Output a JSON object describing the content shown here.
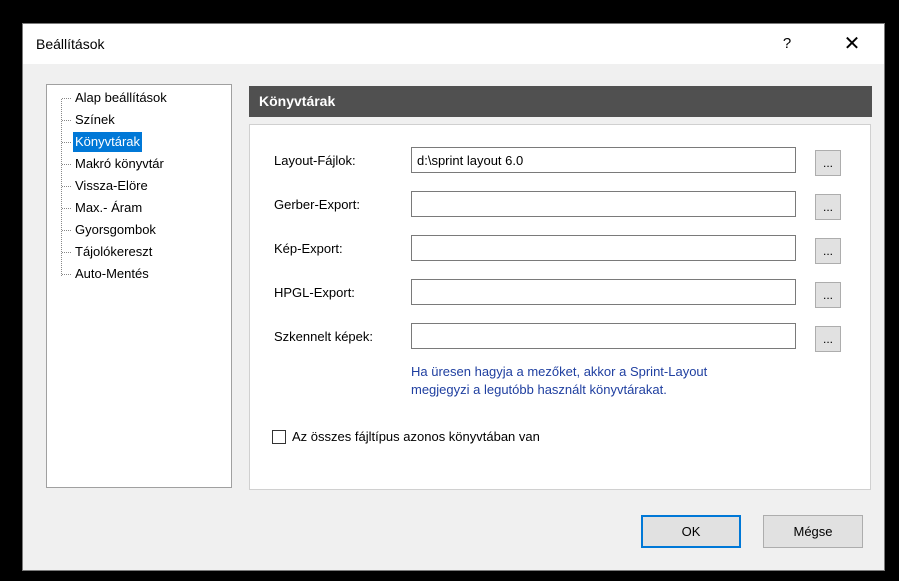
{
  "window": {
    "title": "Beállítások",
    "help": "?",
    "close": "✕"
  },
  "tree": {
    "items": [
      {
        "label": "Alap beállítások",
        "selected": false
      },
      {
        "label": "Színek",
        "selected": false
      },
      {
        "label": "Könyvtárak",
        "selected": true
      },
      {
        "label": "Makró könyvtár",
        "selected": false
      },
      {
        "label": "Vissza-Elöre",
        "selected": false
      },
      {
        "label": "Max.- Áram",
        "selected": false
      },
      {
        "label": "Gyorsgombok",
        "selected": false
      },
      {
        "label": "Tájolókereszt",
        "selected": false
      },
      {
        "label": "Auto-Mentés",
        "selected": false
      }
    ]
  },
  "section": {
    "title": "Könyvtárak",
    "rows": [
      {
        "label": "Layout-Fájlok:",
        "value": "d:\\sprint layout 6.0",
        "browse": "..."
      },
      {
        "label": "Gerber-Export:",
        "value": "",
        "browse": "..."
      },
      {
        "label": "Kép-Export:",
        "value": "",
        "browse": "..."
      },
      {
        "label": "HPGL-Export:",
        "value": "",
        "browse": "..."
      },
      {
        "label": "Szkennelt képek:",
        "value": "",
        "browse": "..."
      }
    ],
    "hint_line1": "Ha üresen hagyja a mezőket, akkor a Sprint-Layout",
    "hint_line2": "megjegyzi a legutóbb használt könyvtárakat.",
    "checkbox_label": "Az összes fájltípus azonos könyvtában van",
    "checkbox_checked": false,
    "hint_color": "#1f3fa0"
  },
  "buttons": {
    "ok": "OK",
    "cancel": "Mégse"
  },
  "colors": {
    "header_bg": "#505050",
    "selection": "#0078d7"
  }
}
